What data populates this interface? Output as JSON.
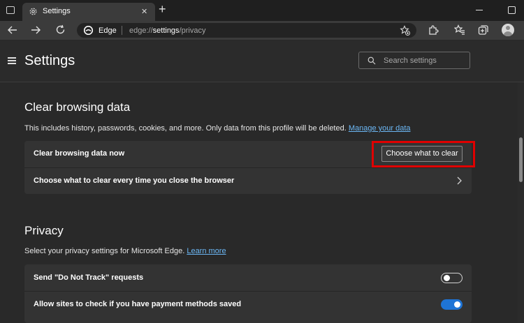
{
  "window": {
    "tab_title": "Settings",
    "tab_close": "✕",
    "new_tab": "+"
  },
  "address_bar": {
    "site_label": "Edge",
    "url_prefix": "edge://",
    "url_bold": "settings",
    "url_suffix": "/privacy"
  },
  "settings_header": {
    "title": "Settings",
    "search_placeholder": "Search settings"
  },
  "clear_browsing": {
    "heading": "Clear browsing data",
    "description": "This includes history, passwords, cookies, and more. Only data from this profile will be deleted.",
    "link": "Manage your data",
    "row1_label": "Clear browsing data now",
    "row1_button": "Choose what to clear",
    "row2_label": "Choose what to clear every time you close the browser"
  },
  "privacy": {
    "heading": "Privacy",
    "description": "Select your privacy settings for Microsoft Edge.",
    "link": "Learn more",
    "row1_label": "Send \"Do Not Track\" requests",
    "row1_enabled": false,
    "row2_label": "Allow sites to check if you have payment methods saved",
    "row2_enabled": true
  },
  "colors": {
    "accent": "#1e74d6",
    "link": "#6cb8f6",
    "highlight": "#e00000"
  }
}
